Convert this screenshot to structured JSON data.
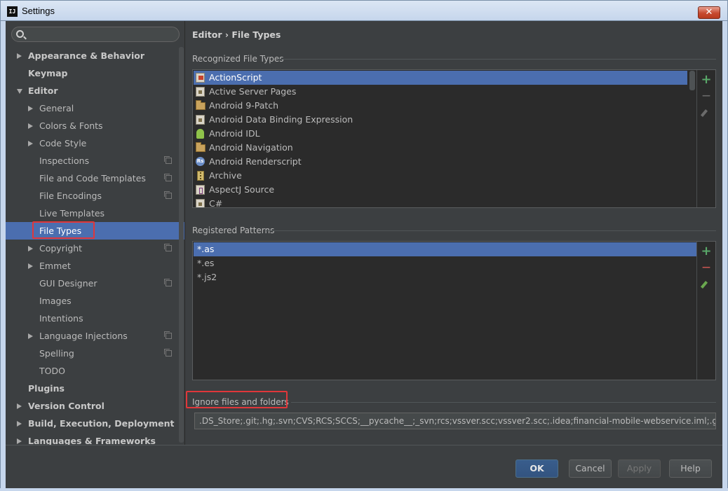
{
  "window": {
    "title": "Settings",
    "logo_text": "IJ",
    "close_glyph": "✕"
  },
  "search": {
    "value": "",
    "placeholder": ""
  },
  "sidebar": {
    "items": [
      {
        "label": "Appearance & Behavior",
        "level": 0,
        "arrow": "right",
        "bold": true
      },
      {
        "label": "Keymap",
        "level": 0,
        "arrow": "none",
        "bold": true
      },
      {
        "label": "Editor",
        "level": 0,
        "arrow": "down",
        "bold": true
      },
      {
        "label": "General",
        "level": 1,
        "arrow": "right"
      },
      {
        "label": "Colors & Fonts",
        "level": 1,
        "arrow": "right"
      },
      {
        "label": "Code Style",
        "level": 1,
        "arrow": "right"
      },
      {
        "label": "Inspections",
        "level": 1,
        "arrow": "none",
        "project_icon": true
      },
      {
        "label": "File and Code Templates",
        "level": 1,
        "arrow": "none",
        "project_icon": true
      },
      {
        "label": "File Encodings",
        "level": 1,
        "arrow": "none",
        "project_icon": true
      },
      {
        "label": "Live Templates",
        "level": 1,
        "arrow": "none"
      },
      {
        "label": "File Types",
        "level": 1,
        "arrow": "none",
        "selected": true
      },
      {
        "label": "Copyright",
        "level": 1,
        "arrow": "right",
        "project_icon": true
      },
      {
        "label": "Emmet",
        "level": 1,
        "arrow": "right"
      },
      {
        "label": "GUI Designer",
        "level": 1,
        "arrow": "none",
        "project_icon": true
      },
      {
        "label": "Images",
        "level": 1,
        "arrow": "none"
      },
      {
        "label": "Intentions",
        "level": 1,
        "arrow": "none"
      },
      {
        "label": "Language Injections",
        "level": 1,
        "arrow": "right",
        "project_icon": true
      },
      {
        "label": "Spelling",
        "level": 1,
        "arrow": "none",
        "project_icon": true
      },
      {
        "label": "TODO",
        "level": 1,
        "arrow": "none"
      },
      {
        "label": "Plugins",
        "level": 0,
        "arrow": "none",
        "bold": true
      },
      {
        "label": "Version Control",
        "level": 0,
        "arrow": "right",
        "bold": true
      },
      {
        "label": "Build, Execution, Deployment",
        "level": 0,
        "arrow": "right",
        "bold": true
      },
      {
        "label": "Languages & Frameworks",
        "level": 0,
        "arrow": "right",
        "bold": true
      }
    ]
  },
  "breadcrumb": "Editor › File Types",
  "recognized": {
    "title": "Recognized File Types",
    "items": [
      {
        "label": "ActionScript",
        "icon": "actionscript-icon",
        "selected": true
      },
      {
        "label": "Active Server Pages",
        "icon": "document-icon"
      },
      {
        "label": "Android 9-Patch",
        "icon": "folder-icon"
      },
      {
        "label": "Android Data Binding Expression",
        "icon": "document-icon"
      },
      {
        "label": "Android IDL",
        "icon": "android-icon"
      },
      {
        "label": "Android Navigation",
        "icon": "folder-icon"
      },
      {
        "label": "Android Renderscript",
        "icon": "renderscript-icon"
      },
      {
        "label": "Archive",
        "icon": "archive-icon"
      },
      {
        "label": "AspectJ Source",
        "icon": "aspectj-icon"
      },
      {
        "label": "C#",
        "icon": "document-icon"
      }
    ]
  },
  "patterns": {
    "title": "Registered Patterns",
    "items": [
      {
        "label": "*.as",
        "selected": true
      },
      {
        "label": "*.es"
      },
      {
        "label": "*.js2"
      }
    ]
  },
  "ignore": {
    "title": "Ignore files and folders",
    "value": ".DS_Store;.git;.hg;.svn;CVS;RCS;SCCS;__pycache__;_svn;rcs;vssver.scc;vssver2.scc;.idea;financial-mobile-webservice.iml;.gitignore;"
  },
  "tools": {
    "add": "+",
    "remove": "—"
  },
  "rs_icon_text": "Rs",
  "buttons": {
    "ok": "OK",
    "cancel": "Cancel",
    "apply": "Apply",
    "help": "Help"
  },
  "colors": {
    "selection": "#4b6eaf",
    "highlight_box": "#e0373a",
    "add_green": "#59a869",
    "remove_red": "#c75450"
  }
}
